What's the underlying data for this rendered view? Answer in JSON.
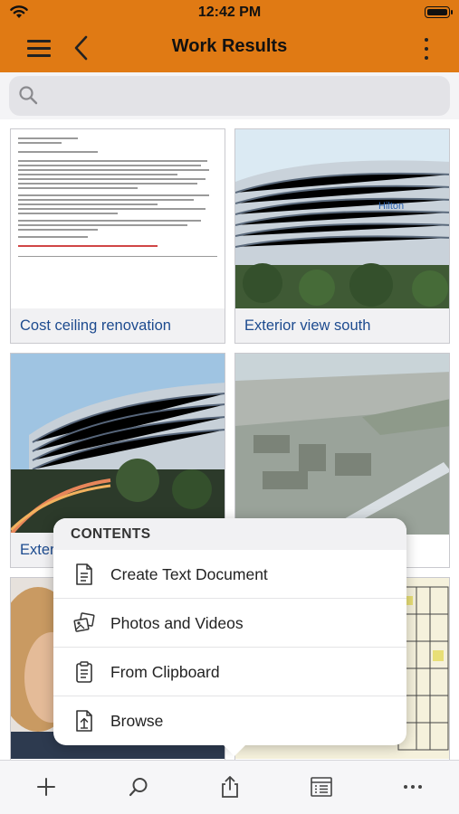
{
  "status": {
    "time": "12:42 PM"
  },
  "nav": {
    "title": "Work Results"
  },
  "search": {
    "placeholder": ""
  },
  "tiles": [
    {
      "caption": "Cost ceiling renovation"
    },
    {
      "caption": "Exterior view  south"
    },
    {
      "caption": "Exter"
    },
    {
      "caption": ""
    }
  ],
  "popup": {
    "header": "CONTENTS",
    "items": [
      {
        "label": "Create Text Document",
        "icon": "document-icon"
      },
      {
        "label": "Photos and Videos",
        "icon": "photos-icon"
      },
      {
        "label": "From Clipboard",
        "icon": "clipboard-icon"
      },
      {
        "label": "Browse",
        "icon": "browse-file-icon"
      }
    ]
  },
  "toolbar": {
    "icons": [
      "add-icon",
      "search-icon",
      "share-icon",
      "list-view-icon",
      "more-icon"
    ]
  },
  "colors": {
    "accent": "#e07a14",
    "link": "#1d4b8f"
  }
}
